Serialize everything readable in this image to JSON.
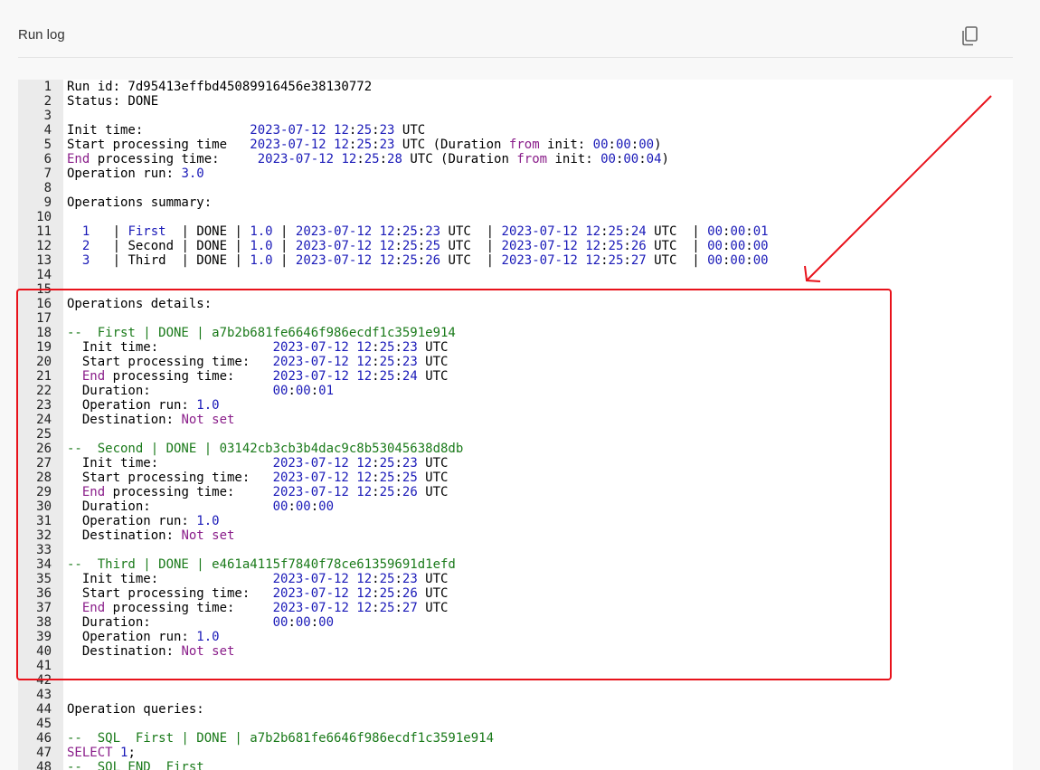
{
  "header": {
    "title": "Run log",
    "copy_icon": "copy-icon"
  },
  "annotation": {
    "color": "#e8121b"
  },
  "log_lines": [
    [
      [
        "p",
        "Run id: 7d95413effbd45089916456e38130772"
      ]
    ],
    [
      [
        "p",
        "Status: DONE"
      ]
    ],
    [],
    [
      [
        "p",
        "Init time:              "
      ],
      [
        "n",
        "2023-07-12 12"
      ],
      [
        "p",
        ":"
      ],
      [
        "n",
        "25"
      ],
      [
        "p",
        ":"
      ],
      [
        "n",
        "23"
      ],
      [
        "p",
        " UTC"
      ]
    ],
    [
      [
        "p",
        "Start processing time   "
      ],
      [
        "n",
        "2023-07-12 12"
      ],
      [
        "p",
        ":"
      ],
      [
        "n",
        "25"
      ],
      [
        "p",
        ":"
      ],
      [
        "n",
        "23"
      ],
      [
        "p",
        " UTC (Duration "
      ],
      [
        "k",
        "from"
      ],
      [
        "p",
        " init: "
      ],
      [
        "n",
        "00"
      ],
      [
        "p",
        ":"
      ],
      [
        "n",
        "00"
      ],
      [
        "p",
        ":"
      ],
      [
        "n",
        "00"
      ],
      [
        "p",
        ")"
      ]
    ],
    [
      [
        "k",
        "End"
      ],
      [
        "p",
        " processing time:     "
      ],
      [
        "n",
        "2023-07-12 12"
      ],
      [
        "p",
        ":"
      ],
      [
        "n",
        "25"
      ],
      [
        "p",
        ":"
      ],
      [
        "n",
        "28"
      ],
      [
        "p",
        " UTC (Duration "
      ],
      [
        "k",
        "from"
      ],
      [
        "p",
        " init: "
      ],
      [
        "n",
        "00"
      ],
      [
        "p",
        ":"
      ],
      [
        "n",
        "00"
      ],
      [
        "p",
        ":"
      ],
      [
        "n",
        "04"
      ],
      [
        "p",
        ")"
      ]
    ],
    [
      [
        "p",
        "Operation run: "
      ],
      [
        "n",
        "3.0"
      ]
    ],
    [],
    [
      [
        "p",
        "Operations summary:"
      ]
    ],
    [],
    [
      [
        "p",
        "  "
      ],
      [
        "n",
        "1"
      ],
      [
        "p",
        "   | "
      ],
      [
        "n",
        "First"
      ],
      [
        "p",
        "  | DONE | "
      ],
      [
        "n",
        "1.0"
      ],
      [
        "p",
        " | "
      ],
      [
        "n",
        "2023-07-12 12"
      ],
      [
        "p",
        ":"
      ],
      [
        "n",
        "25"
      ],
      [
        "p",
        ":"
      ],
      [
        "n",
        "23"
      ],
      [
        "p",
        " UTC  | "
      ],
      [
        "n",
        "2023-07-12 12"
      ],
      [
        "p",
        ":"
      ],
      [
        "n",
        "25"
      ],
      [
        "p",
        ":"
      ],
      [
        "n",
        "24"
      ],
      [
        "p",
        " UTC  | "
      ],
      [
        "n",
        "00"
      ],
      [
        "p",
        ":"
      ],
      [
        "n",
        "00"
      ],
      [
        "p",
        ":"
      ],
      [
        "n",
        "01"
      ]
    ],
    [
      [
        "p",
        "  "
      ],
      [
        "n",
        "2"
      ],
      [
        "p",
        "   | Second | DONE | "
      ],
      [
        "n",
        "1.0"
      ],
      [
        "p",
        " | "
      ],
      [
        "n",
        "2023-07-12 12"
      ],
      [
        "p",
        ":"
      ],
      [
        "n",
        "25"
      ],
      [
        "p",
        ":"
      ],
      [
        "n",
        "25"
      ],
      [
        "p",
        " UTC  | "
      ],
      [
        "n",
        "2023-07-12 12"
      ],
      [
        "p",
        ":"
      ],
      [
        "n",
        "25"
      ],
      [
        "p",
        ":"
      ],
      [
        "n",
        "26"
      ],
      [
        "p",
        " UTC  | "
      ],
      [
        "n",
        "00"
      ],
      [
        "p",
        ":"
      ],
      [
        "n",
        "00"
      ],
      [
        "p",
        ":"
      ],
      [
        "n",
        "00"
      ]
    ],
    [
      [
        "p",
        "  "
      ],
      [
        "n",
        "3"
      ],
      [
        "p",
        "   | Third  | DONE | "
      ],
      [
        "n",
        "1.0"
      ],
      [
        "p",
        " | "
      ],
      [
        "n",
        "2023-07-12 12"
      ],
      [
        "p",
        ":"
      ],
      [
        "n",
        "25"
      ],
      [
        "p",
        ":"
      ],
      [
        "n",
        "26"
      ],
      [
        "p",
        " UTC  | "
      ],
      [
        "n",
        "2023-07-12 12"
      ],
      [
        "p",
        ":"
      ],
      [
        "n",
        "25"
      ],
      [
        "p",
        ":"
      ],
      [
        "n",
        "27"
      ],
      [
        "p",
        " UTC  | "
      ],
      [
        "n",
        "00"
      ],
      [
        "p",
        ":"
      ],
      [
        "n",
        "00"
      ],
      [
        "p",
        ":"
      ],
      [
        "n",
        "00"
      ]
    ],
    [],
    [],
    [
      [
        "p",
        "Operations details:"
      ]
    ],
    [],
    [
      [
        "c",
        "--  First | DONE | a7b2b681fe6646f986ecdf1c3591e914"
      ]
    ],
    [
      [
        "p",
        "  Init time:               "
      ],
      [
        "n",
        "2023-07-12 12"
      ],
      [
        "p",
        ":"
      ],
      [
        "n",
        "25"
      ],
      [
        "p",
        ":"
      ],
      [
        "n",
        "23"
      ],
      [
        "p",
        " UTC"
      ]
    ],
    [
      [
        "p",
        "  Start processing time:   "
      ],
      [
        "n",
        "2023-07-12 12"
      ],
      [
        "p",
        ":"
      ],
      [
        "n",
        "25"
      ],
      [
        "p",
        ":"
      ],
      [
        "n",
        "23"
      ],
      [
        "p",
        " UTC"
      ]
    ],
    [
      [
        "p",
        "  "
      ],
      [
        "k",
        "End"
      ],
      [
        "p",
        " processing time:     "
      ],
      [
        "n",
        "2023-07-12 12"
      ],
      [
        "p",
        ":"
      ],
      [
        "n",
        "25"
      ],
      [
        "p",
        ":"
      ],
      [
        "n",
        "24"
      ],
      [
        "p",
        " UTC"
      ]
    ],
    [
      [
        "p",
        "  Duration:                "
      ],
      [
        "n",
        "00"
      ],
      [
        "p",
        ":"
      ],
      [
        "n",
        "00"
      ],
      [
        "p",
        ":"
      ],
      [
        "n",
        "01"
      ]
    ],
    [
      [
        "p",
        "  Operation run: "
      ],
      [
        "n",
        "1.0"
      ]
    ],
    [
      [
        "p",
        "  Destination: "
      ],
      [
        "k",
        "Not set"
      ]
    ],
    [],
    [
      [
        "c",
        "--  Second | DONE | 03142cb3cb3b4dac9c8b53045638d8db"
      ]
    ],
    [
      [
        "p",
        "  Init time:               "
      ],
      [
        "n",
        "2023-07-12 12"
      ],
      [
        "p",
        ":"
      ],
      [
        "n",
        "25"
      ],
      [
        "p",
        ":"
      ],
      [
        "n",
        "23"
      ],
      [
        "p",
        " UTC"
      ]
    ],
    [
      [
        "p",
        "  Start processing time:   "
      ],
      [
        "n",
        "2023-07-12 12"
      ],
      [
        "p",
        ":"
      ],
      [
        "n",
        "25"
      ],
      [
        "p",
        ":"
      ],
      [
        "n",
        "25"
      ],
      [
        "p",
        " UTC"
      ]
    ],
    [
      [
        "p",
        "  "
      ],
      [
        "k",
        "End"
      ],
      [
        "p",
        " processing time:     "
      ],
      [
        "n",
        "2023-07-12 12"
      ],
      [
        "p",
        ":"
      ],
      [
        "n",
        "25"
      ],
      [
        "p",
        ":"
      ],
      [
        "n",
        "26"
      ],
      [
        "p",
        " UTC"
      ]
    ],
    [
      [
        "p",
        "  Duration:                "
      ],
      [
        "n",
        "00"
      ],
      [
        "p",
        ":"
      ],
      [
        "n",
        "00"
      ],
      [
        "p",
        ":"
      ],
      [
        "n",
        "00"
      ]
    ],
    [
      [
        "p",
        "  Operation run: "
      ],
      [
        "n",
        "1.0"
      ]
    ],
    [
      [
        "p",
        "  Destination: "
      ],
      [
        "k",
        "Not set"
      ]
    ],
    [],
    [
      [
        "c",
        "--  Third | DONE | e461a4115f7840f78ce61359691d1efd"
      ]
    ],
    [
      [
        "p",
        "  Init time:               "
      ],
      [
        "n",
        "2023-07-12 12"
      ],
      [
        "p",
        ":"
      ],
      [
        "n",
        "25"
      ],
      [
        "p",
        ":"
      ],
      [
        "n",
        "23"
      ],
      [
        "p",
        " UTC"
      ]
    ],
    [
      [
        "p",
        "  Start processing time:   "
      ],
      [
        "n",
        "2023-07-12 12"
      ],
      [
        "p",
        ":"
      ],
      [
        "n",
        "25"
      ],
      [
        "p",
        ":"
      ],
      [
        "n",
        "26"
      ],
      [
        "p",
        " UTC"
      ]
    ],
    [
      [
        "p",
        "  "
      ],
      [
        "k",
        "End"
      ],
      [
        "p",
        " processing time:     "
      ],
      [
        "n",
        "2023-07-12 12"
      ],
      [
        "p",
        ":"
      ],
      [
        "n",
        "25"
      ],
      [
        "p",
        ":"
      ],
      [
        "n",
        "27"
      ],
      [
        "p",
        " UTC"
      ]
    ],
    [
      [
        "p",
        "  Duration:                "
      ],
      [
        "n",
        "00"
      ],
      [
        "p",
        ":"
      ],
      [
        "n",
        "00"
      ],
      [
        "p",
        ":"
      ],
      [
        "n",
        "00"
      ]
    ],
    [
      [
        "p",
        "  Operation run: "
      ],
      [
        "n",
        "1.0"
      ]
    ],
    [
      [
        "p",
        "  Destination: "
      ],
      [
        "k",
        "Not set"
      ]
    ],
    [],
    [],
    [],
    [
      [
        "p",
        "Operation queries:"
      ]
    ],
    [],
    [
      [
        "c",
        "--  SQL  First | DONE | a7b2b681fe6646f986ecdf1c3591e914"
      ]
    ],
    [
      [
        "k",
        "SELECT"
      ],
      [
        "p",
        " "
      ],
      [
        "n",
        "1"
      ],
      [
        "p",
        ";"
      ]
    ],
    [
      [
        "c",
        "--  SQL END  First"
      ]
    ]
  ]
}
